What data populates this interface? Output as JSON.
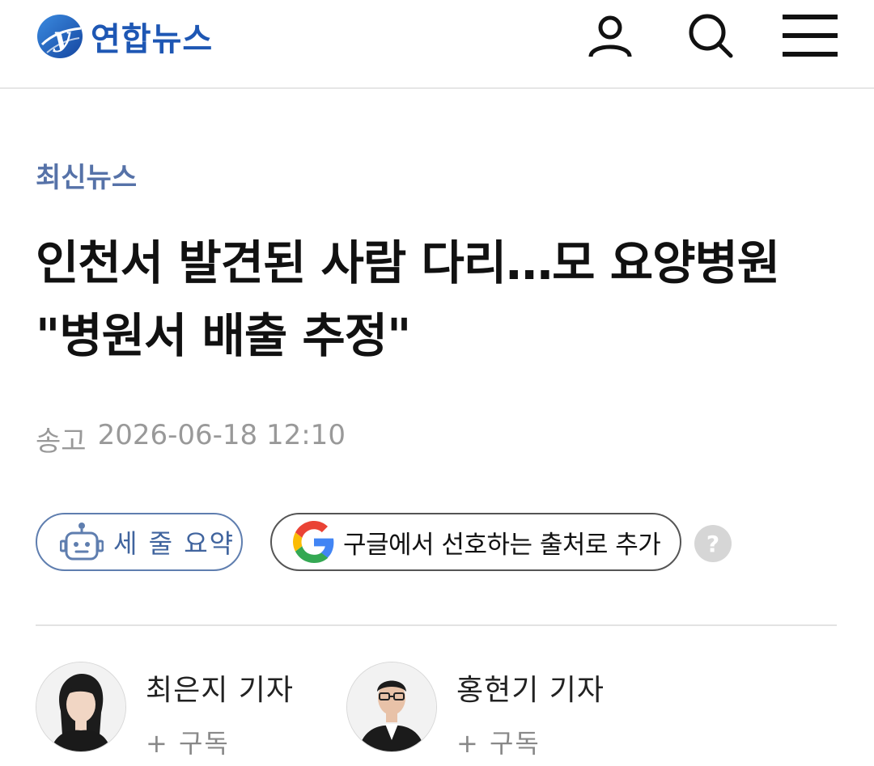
{
  "header": {
    "logo_text": "연합뉴스",
    "icons": [
      "user-icon",
      "search-icon",
      "menu-icon"
    ]
  },
  "article": {
    "category": "최신뉴스",
    "headline": "인천서 발견된 사람 다리…모 요양병원 \"병원서 배출 추정\"",
    "date_label": "송고",
    "date_value": "2026-06-18 12:10"
  },
  "actions": {
    "summary_label": "세 줄 요약",
    "google_label": "구글에서 선호하는 출처로 추가",
    "help_label": "?"
  },
  "reporters": [
    {
      "name": "최은지 기자",
      "subscribe_label": "+ 구독"
    },
    {
      "name": "홍현기 기자",
      "subscribe_label": "+ 구독"
    }
  ],
  "colors": {
    "brand_blue": "#1e57b4",
    "category_blue": "#5672a8",
    "summary_blue": "#40649e",
    "muted_gray": "#999999"
  }
}
